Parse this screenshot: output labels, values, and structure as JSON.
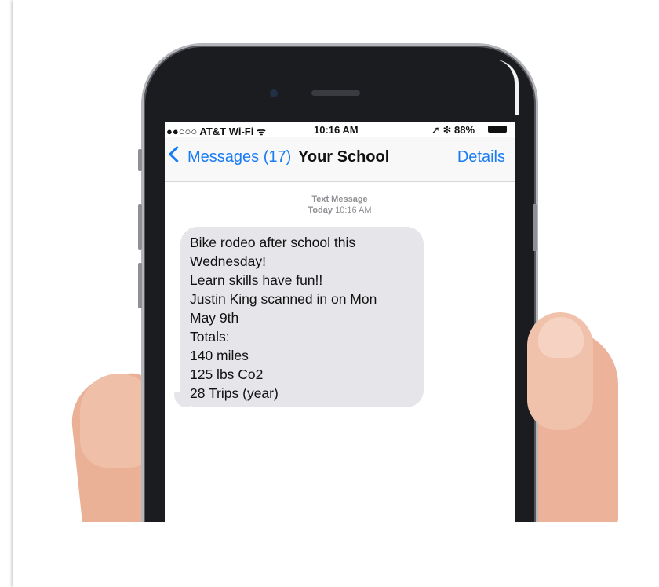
{
  "status_bar": {
    "carrier": "●●○○○ AT&T Wi-Fi ᯤ",
    "time": "10:16 AM",
    "battery": "➚ ✻ 88%"
  },
  "nav": {
    "back_label": "Messages (17)",
    "title": "Your School",
    "details_label": "Details"
  },
  "thread_meta": {
    "type": "Text Message",
    "day": "Today",
    "time": "10:16 AM"
  },
  "message": {
    "lines": [
      "Bike rodeo after school this",
      "Wednesday!",
      "Learn skills have fun!!",
      "Justin King scanned in on Mon",
      "May 9th",
      "Totals:",
      "140 miles",
      "125 lbs Co2",
      "28 Trips (year)"
    ]
  },
  "colors": {
    "ios_blue": "#1a7cf5",
    "bubble_gray": "#e5e5ea"
  }
}
